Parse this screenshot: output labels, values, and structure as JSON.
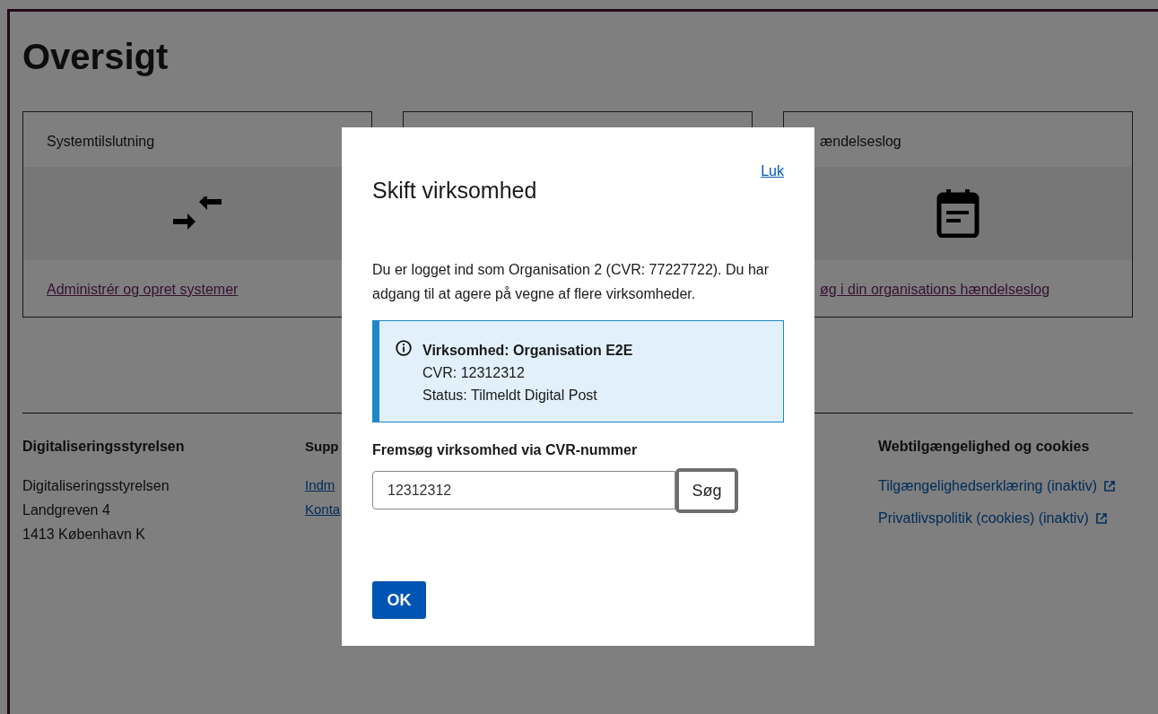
{
  "page": {
    "title": "Oversigt"
  },
  "cards": [
    {
      "title": "Systemtilslutning",
      "kind": "connection",
      "link": "Administrér og opret systemer"
    },
    {
      "title": "ændelseslog",
      "kind": "log",
      "link": "øg i din organisations hændelseslog"
    }
  ],
  "footer": {
    "columns": [
      {
        "heading": "Digitaliseringsstyrelsen",
        "lines": [
          {
            "kind": "text",
            "text": "Digitaliseringsstyrelsen"
          },
          {
            "kind": "text",
            "text": "Landgreven 4"
          },
          {
            "kind": "text",
            "text": "1413 København K"
          }
        ]
      },
      {
        "heading": "Supp",
        "lines": [
          {
            "kind": "link",
            "text": "Indm"
          },
          {
            "kind": "link",
            "text": "Konta"
          }
        ]
      },
      {
        "heading": "Webtilgængelighed og cookies",
        "lines": [
          {
            "kind": "link",
            "text": "Tilgængelighedserklæring (inaktiv)",
            "external": true
          },
          {
            "kind": "link",
            "text": "Privatlivspolitik (cookies) (inaktiv)",
            "external": true
          }
        ]
      }
    ]
  },
  "dialog": {
    "title": "Skift virksomhed",
    "close": "Luk",
    "intro": "Du er logget ind som Organisation 2 (CVR: 77227722). Du har adgang til at agere på vegne af flere virksomheder.",
    "info": {
      "lines": [
        "Virksomhed: Organisation E2E",
        "CVR: 12312312",
        "Status: Tilmeldt Digital Post"
      ]
    },
    "search": {
      "label": "Fremsøg virksomhed via CVR-nummer",
      "value": "12312312",
      "button": "Søg"
    },
    "ok": "OK"
  }
}
